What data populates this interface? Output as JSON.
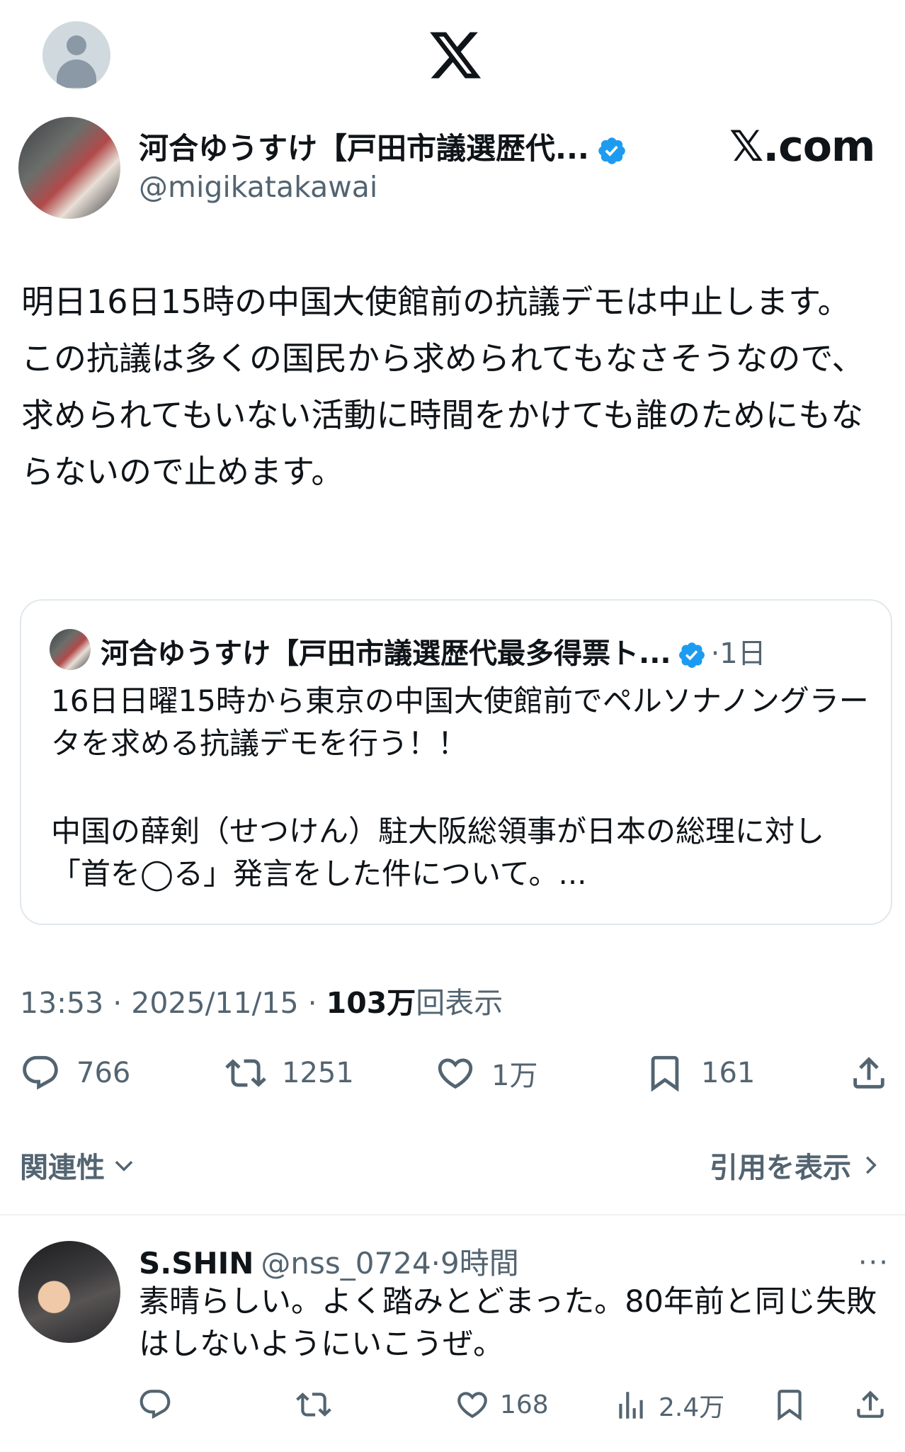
{
  "top_bar": {
    "logo": "x-logo"
  },
  "author": {
    "name": "河合ゆうすけ【戸田市議選歴代...",
    "handle": "@migikatakawai",
    "verified": true
  },
  "watermark": "𝕏.com",
  "tweet": {
    "paragraphs": [
      "明日16日15時の中国大使館前の抗議デモは中止します。",
      "この抗議は多くの国民から求められてもなさそうなので、求められてもいない活動に時間をかけても誰のためにもならないので止めます。"
    ]
  },
  "quote": {
    "name": "河合ゆうすけ【戸田市議選歴代最多得票ト...",
    "time": "·1日",
    "lines": [
      "16日日曜15時から東京の中国大使館前でペルソナノングラータを求める抗議デモを行う！！",
      "中国の薛剣（せつけん）駐大阪総領事が日本の総理に対し「首を◯る」発言をした件について。..."
    ]
  },
  "meta": {
    "time": "13:53 · 2025/11/15 · ",
    "views_number": "103万",
    "views_label": "回表示"
  },
  "actions": {
    "replies": "766",
    "retweets": "1251",
    "likes": "1万",
    "bookmarks": "161"
  },
  "related_label": "関連性",
  "quotes_label": "引用を表示",
  "reply": {
    "name": "S.SHIN",
    "handle": "@nss_0724",
    "time": "·9時間",
    "more": "···",
    "text": "素晴らしい。よく踏みとどまった。80年前と同じ失敗はしないようにいこうぜ。",
    "likes": "168",
    "views": "2.4万"
  },
  "colors": {
    "verified": "#1d9bf0",
    "muted": "#536471",
    "text": "#0f1419"
  }
}
